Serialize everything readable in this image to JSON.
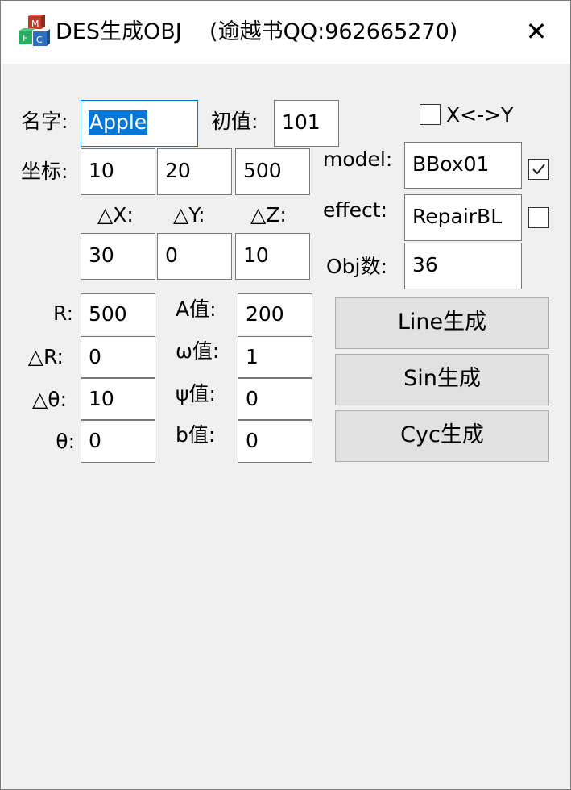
{
  "window": {
    "title": "DES生成OBJ    (逾越书QQ:962665270)",
    "close_glyph": "✕",
    "icon": "mfc-blocks-icon"
  },
  "form": {
    "name_label": "名字:",
    "name_value": "Apple",
    "init_label": "初值:",
    "init_value": "101",
    "swap_label": "X<->Y",
    "swap_checked": false,
    "coord_label": "坐标:",
    "coord_x": "10",
    "coord_y": "20",
    "coord_z": "500",
    "dx_label": "△X:",
    "dy_label": "△Y:",
    "dz_label": "△Z:",
    "dx_value": "30",
    "dy_value": "0",
    "dz_value": "10",
    "model_label": "model:",
    "model_value": "BBox01",
    "model_checked": true,
    "effect_label": "effect:",
    "effect_value": "RepairBL",
    "effect_checked": false,
    "obj_label": "Obj数:",
    "obj_value": "36",
    "r_label": "R:",
    "r_value": "500",
    "dr_label": "△R:",
    "dr_value": "0",
    "dtheta_label": "△θ:",
    "dtheta_value": "10",
    "theta_label": "θ:",
    "theta_value": "0",
    "a_label": "A值:",
    "a_value": "200",
    "omega_label": "ω值:",
    "omega_value": "1",
    "psi_label": "ψ值:",
    "psi_value": "0",
    "b_label": "b值:",
    "b_value": "0"
  },
  "buttons": {
    "line": "Line生成",
    "sin": "Sin生成",
    "cyc": "Cyc生成"
  }
}
